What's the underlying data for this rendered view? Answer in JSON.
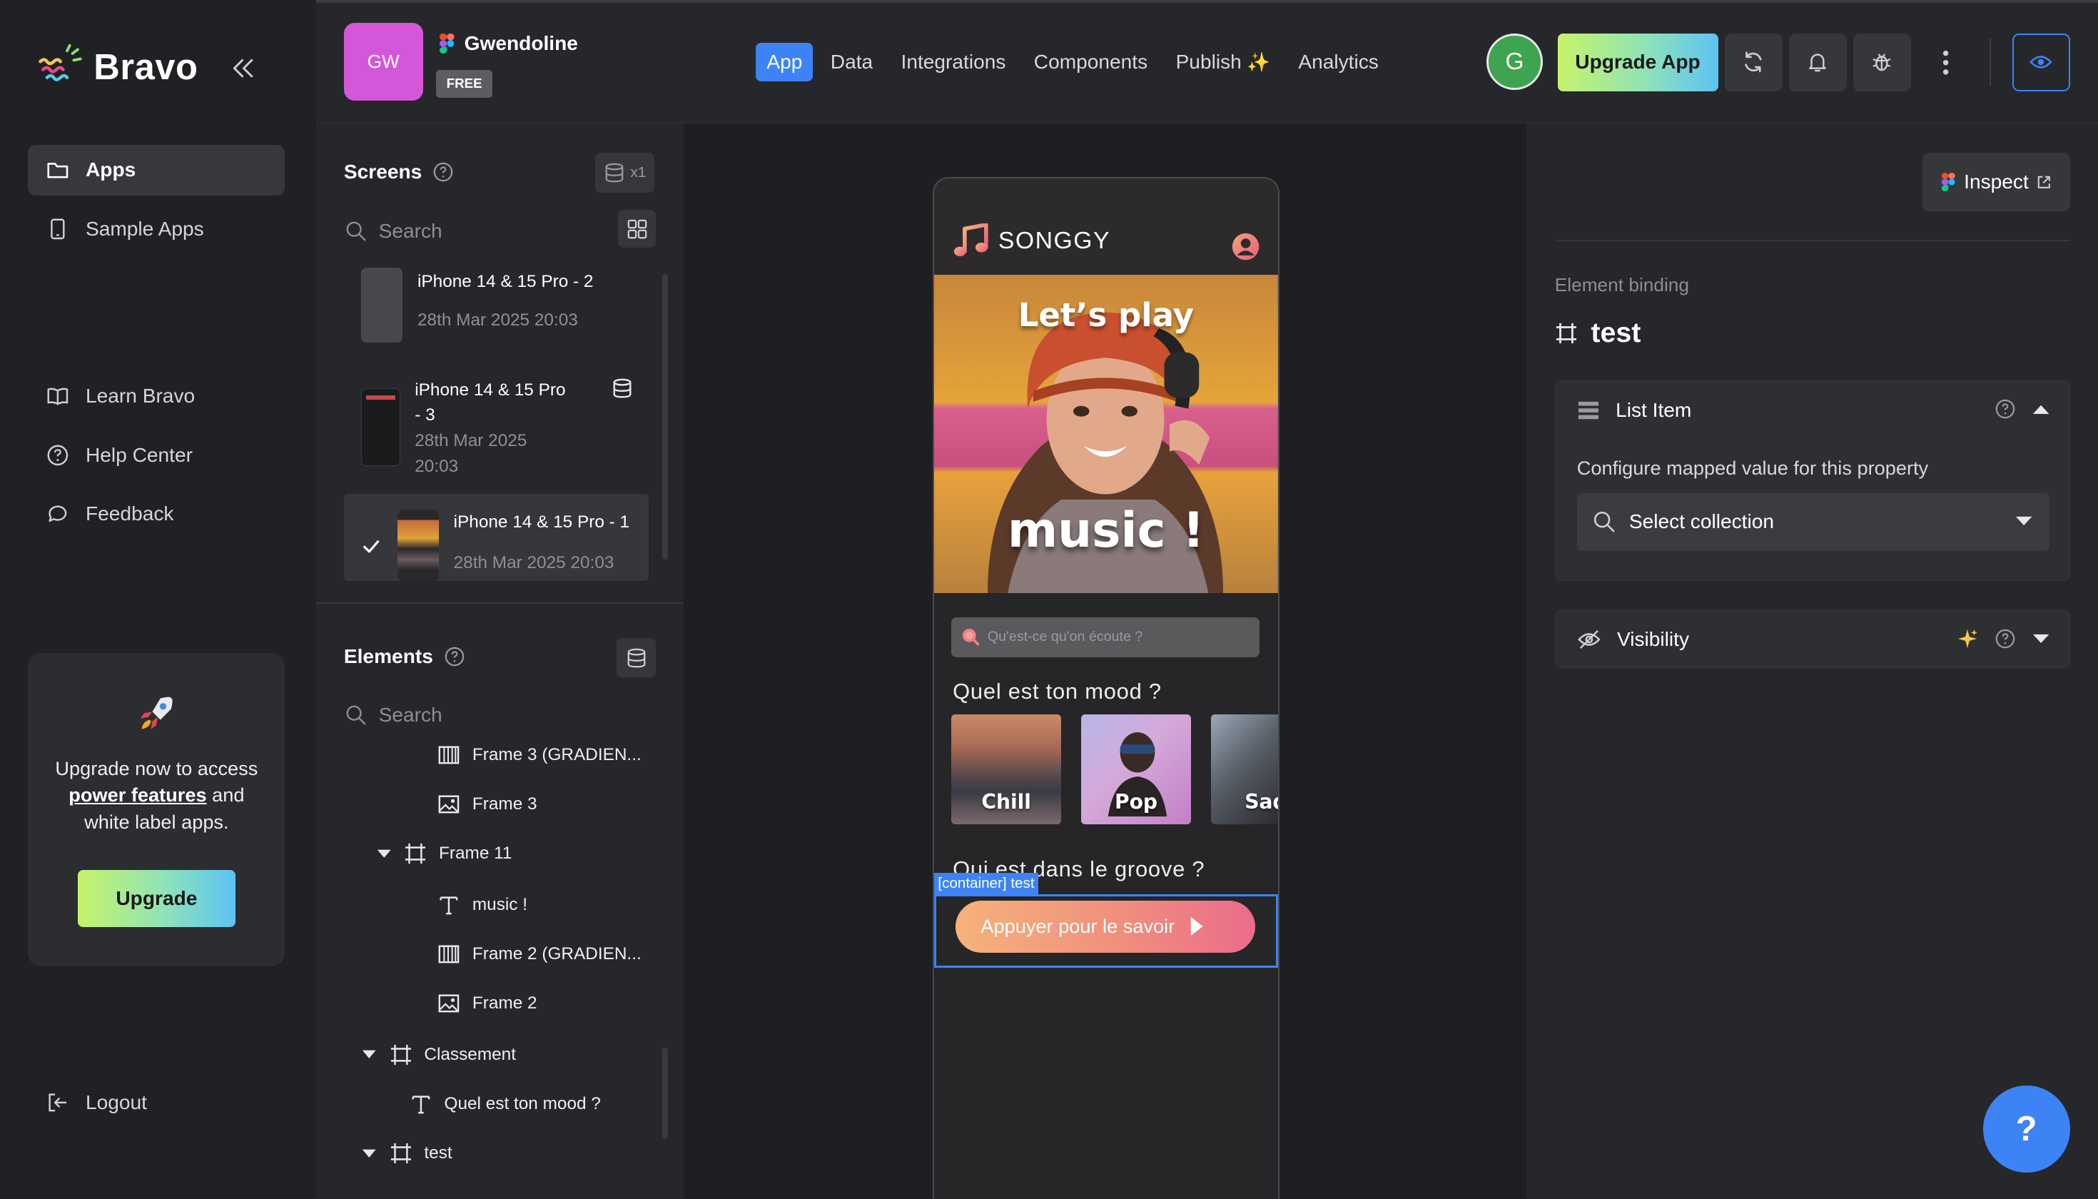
{
  "brand": {
    "name": "Bravo"
  },
  "nav": {
    "primary": [
      {
        "label": "Apps",
        "icon": "folder-icon",
        "active": true
      },
      {
        "label": "Sample Apps",
        "icon": "phone-icon",
        "active": false
      }
    ],
    "secondary": [
      {
        "label": "Learn Bravo",
        "icon": "book-icon"
      },
      {
        "label": "Help Center",
        "icon": "help-circle-icon"
      },
      {
        "label": "Feedback",
        "icon": "chat-bubble-icon"
      }
    ],
    "logout": "Logout"
  },
  "upgrade_card": {
    "line1": "Upgrade now to access",
    "highlight": "power features",
    "line2": " and",
    "line3": "white label apps.",
    "button": "Upgrade"
  },
  "topbar": {
    "avatar_initials": "GW",
    "project_name": "Gwendoline",
    "plan": "FREE",
    "tabs": [
      "App",
      "Data",
      "Integrations",
      "Components",
      "Publish",
      "Analytics"
    ],
    "active_tab": "App",
    "publish_sparkle": "✨",
    "user_initial": "G",
    "upgrade_button": "Upgrade App"
  },
  "screens": {
    "title": "Screens",
    "count_badge": "x1",
    "search_placeholder": "Search",
    "items": [
      {
        "title": "iPhone 14 & 15 Pro - 2",
        "date": "28th Mar 2025 20:03",
        "selected": false
      },
      {
        "title_l1": "iPhone 14 & 15 Pro",
        "title_l2": "- 3",
        "date_l1": "28th Mar 2025",
        "date_l2": "20:03",
        "selected": false
      },
      {
        "title": "iPhone 14 & 15 Pro - 1",
        "date": "28th Mar 2025 20:03",
        "selected": true
      }
    ]
  },
  "elements": {
    "title": "Elements",
    "search_placeholder": "Search",
    "tree": [
      {
        "label": "Frame 3 (GRADIEN...",
        "icon": "gradient-icon",
        "depth": 3
      },
      {
        "label": "Frame 3",
        "icon": "image-icon",
        "depth": 3
      },
      {
        "label": "Frame 11",
        "icon": "frame-icon",
        "depth": 2,
        "expanded": true
      },
      {
        "label": "music !",
        "icon": "text-icon",
        "depth": 3
      },
      {
        "label": "Frame 2 (GRADIEN...",
        "icon": "gradient-icon",
        "depth": 3
      },
      {
        "label": "Frame 2",
        "icon": "image-icon",
        "depth": 3
      },
      {
        "label": "Classement",
        "icon": "frame-icon",
        "depth": 1,
        "expanded": true
      },
      {
        "label": "Quel est ton mood ?",
        "icon": "text-icon",
        "depth": 2
      },
      {
        "label": "test",
        "icon": "frame-icon",
        "depth": 1,
        "expanded": true
      }
    ]
  },
  "phone": {
    "app_title": "SONGGY",
    "hero_line1": "Let’s play",
    "hero_line2": "music !",
    "search_placeholder": "Qu'est-ce qu'on écoute ?",
    "mood_title": "Quel est ton mood ?",
    "moods": [
      "Chill",
      "Pop",
      "Sad"
    ],
    "groove_title": "Qui est dans le groove ?",
    "selection_tag": "[container] test",
    "cta": "Appuyer pour le savoir"
  },
  "inspector": {
    "inspect_button": "Inspect",
    "binding_label": "Element binding",
    "element_name": "test",
    "list_item": {
      "title": "List Item",
      "config_text": "Configure mapped value for this property",
      "select_placeholder": "Select collection"
    },
    "visibility": {
      "title": "Visibility"
    }
  },
  "help_fab": "?",
  "colors": {
    "accent": "#3d83f5",
    "app_avatar": "#d457d9",
    "user_avatar": "#3ea44f"
  }
}
